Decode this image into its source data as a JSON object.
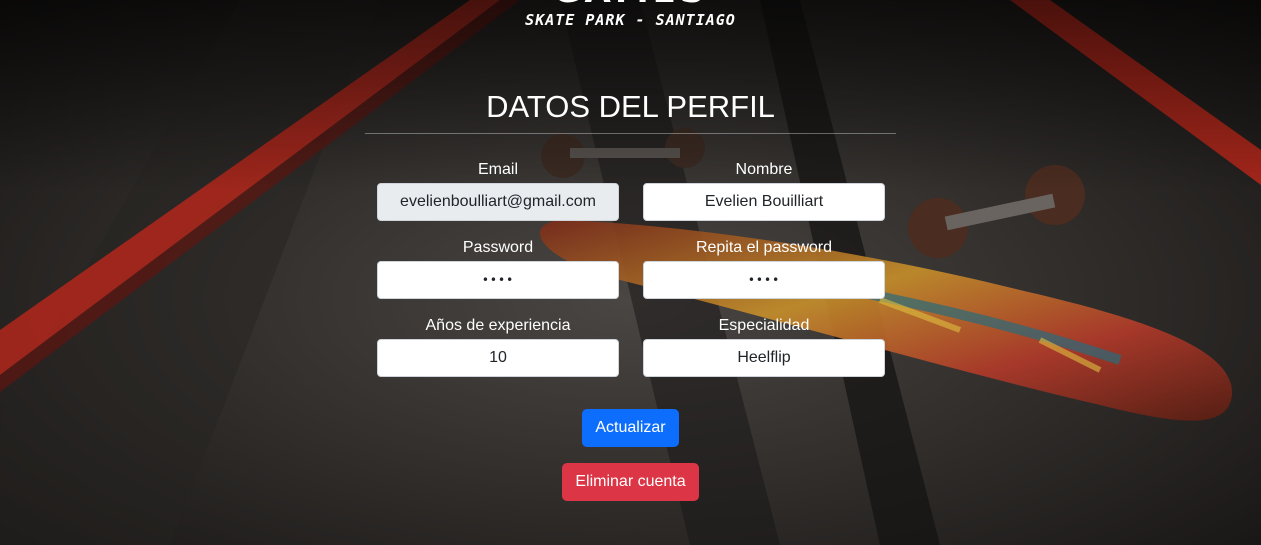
{
  "brand": {
    "title": "GAMES",
    "subtitle": "SKATE PARK - SANTIAGO"
  },
  "profile": {
    "title": "DATOS DEL PERFIL"
  },
  "form": {
    "email": {
      "label": "Email",
      "value": "evelienboulliart@gmail.com"
    },
    "nombre": {
      "label": "Nombre",
      "value": "Evelien Bouilliart"
    },
    "password": {
      "label": "Password",
      "value": "••••"
    },
    "password_repeat": {
      "label": "Repita el password",
      "value": "••••"
    },
    "experiencia": {
      "label": "Años de experiencia",
      "value": "10"
    },
    "especialidad": {
      "label": "Especialidad",
      "value": "Heelflip"
    }
  },
  "actions": {
    "update_label": "Actualizar",
    "delete_label": "Eliminar cuenta"
  },
  "colors": {
    "primary": "#0d6efd",
    "danger": "#dc3545",
    "background": "#1c1a19",
    "rail": "#b3271b"
  },
  "background_image": "skateboard on a ramp with red painted rails (photo)"
}
